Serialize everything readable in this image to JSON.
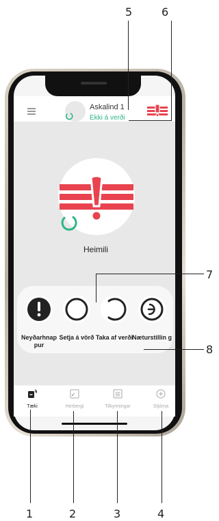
{
  "callouts": [
    "1",
    "2",
    "3",
    "4",
    "5",
    "6",
    "7",
    "8"
  ],
  "header": {
    "device_name": "Askalind 1",
    "device_state": "Ekki á verði"
  },
  "main": {
    "location": "Heimili"
  },
  "actions": [
    {
      "label": "Neyðarhnap pur",
      "icon": "exclamation-icon"
    },
    {
      "label": "Setja á vörð",
      "icon": "circle-icon"
    },
    {
      "label": "Taka af verði",
      "icon": "open-circle-icon"
    },
    {
      "label": "Næturstillin g",
      "icon": "night-mode-icon"
    }
  ],
  "tabs": [
    {
      "label": "Tæki",
      "icon": "device-icon",
      "active": true
    },
    {
      "label": "Herbergi",
      "icon": "rooms-icon",
      "active": false
    },
    {
      "label": "Tilkynningar",
      "icon": "notifications-icon",
      "active": false
    },
    {
      "label": "Stjórna",
      "icon": "control-icon",
      "active": false
    }
  ],
  "colors": {
    "alarm_red": "#e8434f",
    "status_green": "#2db58a",
    "active_tab": "#222222",
    "inactive_tab": "#aaaaaa"
  }
}
